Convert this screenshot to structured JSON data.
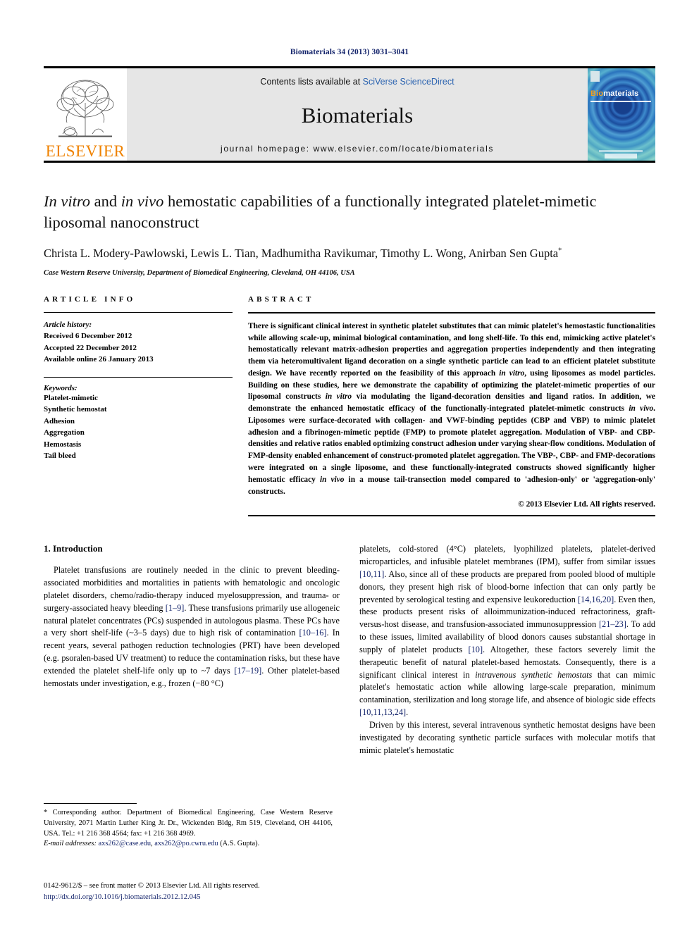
{
  "running_head": "Biomaterials 34 (2013) 3031–3041",
  "masthead": {
    "publisher_name": "ELSEVIER",
    "contents_prefix": "Contents lists available at ",
    "contents_link": "SciVerse ScienceDirect",
    "journal_name": "Biomaterials",
    "homepage_label": "journal homepage: www.elsevier.com/locate/biomaterials",
    "cover": {
      "title_part1": "Bio",
      "title_part2": "materials"
    }
  },
  "article": {
    "title_html": "<i>In vitro</i> and <i>in vivo</i> hemostatic capabilities of a functionally integrated platelet-mimetic liposomal nanoconstruct",
    "authors": "Christa L. Modery-Pawlowski, Lewis L. Tian, Madhumitha Ravikumar, Timothy L. Wong, Anirban Sen Gupta",
    "corresponding_marker": "*",
    "affiliation": "Case Western Reserve University, Department of Biomedical Engineering, Cleveland, OH 44106, USA"
  },
  "article_info": {
    "label": "ARTICLE INFO",
    "history_header": "Article history:",
    "history": [
      "Received 6 December 2012",
      "Accepted 22 December 2012",
      "Available online 26 January 2013"
    ],
    "keywords_header": "Keywords:",
    "keywords": [
      "Platelet-mimetic",
      "Synthetic hemostat",
      "Adhesion",
      "Aggregation",
      "Hemostasis",
      "Tail bleed"
    ]
  },
  "abstract": {
    "label": "ABSTRACT",
    "text_html": "There is significant clinical interest in synthetic platelet substitutes that can mimic platelet's hemostastic functionalities while allowing scale-up, minimal biological contamination, and long shelf-life. To this end, mimicking active platelet's hemostatically relevant matrix-adhesion properties and aggregation properties independently and then integrating them via heteromultivalent ligand decoration on a single synthetic particle can lead to an efficient platelet substitute design. We have recently reported on the feasibility of this approach <i>in vitro</i>, using liposomes as model particles. Building on these studies, here we demonstrate the capability of optimizing the platelet-mimetic properties of our liposomal constructs <i>in vitro</i> via modulating the ligand-decoration densities and ligand ratios. In addition, we demonstrate the enhanced hemostatic efficacy of the functionally-integrated platelet-mimetic constructs <i>in vivo</i>. Liposomes were surface-decorated with collagen- and VWF-binding peptides (CBP and VBP) to mimic platelet adhesion and a fibrinogen-mimetic peptide (FMP) to promote platelet aggregation. Modulation of VBP- and CBP-densities and relative ratios enabled optimizing construct adhesion under varying shear-flow conditions. Modulation of FMP-density enabled enhancement of construct-promoted platelet aggregation. The VBP-, CBP- and FMP-decorations were integrated on a single liposome, and these functionally-integrated constructs showed significantly higher hemostatic efficacy <i>in vivo</i> in a mouse tail-transection model compared to 'adhesion-only' or 'aggregation-only' constructs.",
    "copyright": "© 2013 Elsevier Ltd. All rights reserved."
  },
  "body": {
    "section_number_title": "1. Introduction",
    "left_paragraphs_html": [
      "Platelet transfusions are routinely needed in the clinic to prevent bleeding-associated morbidities and mortalities in patients with hematologic and oncologic platelet disorders, chemo/radio-therapy induced myelosuppression, and trauma- or surgery-associated heavy bleeding <span class=\"ref\">[1&ndash;9]</span>. These transfusions primarily use allogeneic natural platelet concentrates (PCs) suspended in autologous plasma. These PCs have a very short shelf-life (~3&ndash;5 days) due to high risk of contamination <span class=\"ref\">[10&ndash;16]</span>. In recent years, several pathogen reduction technologies (PRT) have been developed (e.g. psoralen-based UV treatment) to reduce the contamination risks, but these have extended the platelet shelf-life only up to ~7 days <span class=\"ref\">[17&ndash;19]</span>. Other platelet-based hemostats under investigation, e.g., frozen (&minus;80 &deg;C)"
    ],
    "right_paragraphs_html": [
      "platelets, cold-stored (4&deg;C) platelets, lyophilized platelets, platelet-derived microparticles, and infusible platelet membranes (IPM), suffer from similar issues <span class=\"ref\">[10,11]</span>. Also, since all of these products are prepared from pooled blood of multiple donors, they present high risk of blood-borne infection that can only partly be prevented by serological testing and expensive leukoreduction <span class=\"ref\">[14,16,20]</span>. Even then, these products present risks of alloimmunization-induced refractoriness, graft-versus-host disease, and transfusion-associated immunosuppression <span class=\"ref\">[21&ndash;23]</span>. To add to these issues, limited availability of blood donors causes substantial shortage in supply of platelet products <span class=\"ref\">[10]</span>. Altogether, these factors severely limit the therapeutic benefit of natural platelet-based hemostats. Consequently, there is a significant clinical interest in <i>intravenous synthetic hemostats</i> that can mimic platelet's hemostatic action while allowing large-scale preparation, minimum contamination, sterilization and long storage life, and absence of biologic side effects <span class=\"ref\">[10,11,13,24]</span>.",
      "Driven by this interest, several intravenous synthetic hemostat designs have been investigated by decorating synthetic particle surfaces with molecular motifs that mimic platelet's hemostatic"
    ]
  },
  "footnote": {
    "corresponding_html": "* Corresponding author. Department of Biomedical Engineering, Case Western Reserve University, 2071 Martin Luther King Jr. Dr., Wickenden Bldg, Rm 519, Cleveland, OH 44106, USA. Tel.: +1 216 368 4564; fax: +1 216 368 4969.",
    "email_html": "<span class=\"em-label\">E-mail addresses:</span> <span class=\"lnk\">axs262@case.edu</span>, <span class=\"lnk\">axs262@po.cwru.edu</span> (A.S. Gupta)."
  },
  "frontmatter": {
    "issn_line": "0142-9612/$ – see front matter © 2013 Elsevier Ltd. All rights reserved.",
    "doi": "http://dx.doi.org/10.1016/j.biomaterials.2012.12.045"
  }
}
